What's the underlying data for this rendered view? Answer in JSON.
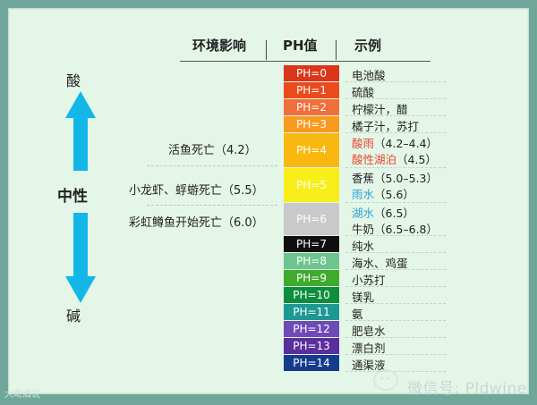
{
  "header": {
    "effect": "环境影响",
    "ph": "PH值",
    "example": "示例"
  },
  "side": {
    "acid": "酸",
    "neutral": "中性",
    "base": "碱"
  },
  "effects": [
    {
      "text": "活鱼死亡（4.2）"
    },
    {
      "text": "小龙虾、蜉蝣死亡（5.5）"
    },
    {
      "text": "彩虹鳟鱼开始死亡（6.0）"
    }
  ],
  "ph_levels": [
    {
      "label": "PH=0",
      "color": "#d9361b",
      "example": [
        {
          "t": "电池酸",
          "c": "#222222"
        }
      ]
    },
    {
      "label": "PH=1",
      "color": "#ea4a1c",
      "example": [
        {
          "t": "硫酸",
          "c": "#222222"
        }
      ]
    },
    {
      "label": "PH=2",
      "color": "#f06f3a",
      "example": [
        {
          "t": "柠檬汁，醋",
          "c": "#222222"
        }
      ]
    },
    {
      "label": "PH=3",
      "color": "#f79a20",
      "example": [
        {
          "t": "橘子汁，苏打",
          "c": "#222222"
        }
      ]
    },
    {
      "label": "PH=4",
      "color": "#f8b80f",
      "example": [
        {
          "t": "酸雨",
          "c": "#e8472a"
        },
        {
          "t": "（4.2–4.4）",
          "c": "#222222"
        }
      ],
      "example2": [
        {
          "t": "酸性湖泊",
          "c": "#e8472a"
        },
        {
          "t": "（4.5）",
          "c": "#222222"
        }
      ]
    },
    {
      "label": "PH=5",
      "color": "#f8ee1a",
      "example": [
        {
          "t": "香蕉（5.0–5.3）",
          "c": "#222222"
        }
      ],
      "example2": [
        {
          "t": "雨水",
          "c": "#2ea3d8"
        },
        {
          "t": "（5.6）",
          "c": "#222222"
        }
      ]
    },
    {
      "label": "PH=6",
      "color": "#c9c9c9",
      "example": [
        {
          "t": "湖水",
          "c": "#2ea3d8"
        },
        {
          "t": "（6.5）",
          "c": "#222222"
        }
      ],
      "example2": [
        {
          "t": "牛奶（6.5–6.8）",
          "c": "#222222"
        }
      ]
    },
    {
      "label": "PH=7",
      "color": "#0f0f0f",
      "example": [
        {
          "t": "纯水",
          "c": "#222222"
        }
      ]
    },
    {
      "label": "PH=8",
      "color": "#6cc58e",
      "example": [
        {
          "t": "海水、鸡蛋",
          "c": "#222222"
        }
      ]
    },
    {
      "label": "PH=9",
      "color": "#3faa2c",
      "example": [
        {
          "t": "小苏打",
          "c": "#222222"
        }
      ]
    },
    {
      "label": "PH=10",
      "color": "#0c8e3d",
      "example": [
        {
          "t": "镁乳",
          "c": "#222222"
        }
      ]
    },
    {
      "label": "PH=11",
      "color": "#1d9892",
      "example": [
        {
          "t": "氨",
          "c": "#222222"
        }
      ]
    },
    {
      "label": "PH=12",
      "color": "#6d4ab7",
      "example": [
        {
          "t": "肥皂水",
          "c": "#222222"
        }
      ]
    },
    {
      "label": "PH=13",
      "color": "#5a2e9e",
      "example": [
        {
          "t": "漂白剂",
          "c": "#222222"
        }
      ]
    },
    {
      "label": "PH=14",
      "color": "#143c8e",
      "example": [
        {
          "t": "通渠液",
          "c": "#222222"
        }
      ]
    }
  ],
  "watermark": {
    "wechat": "微信号: Pldwine",
    "logo": "大毗酒说"
  },
  "colors": {
    "arrow": "#12b7e8",
    "background": "#6fa79a",
    "panel": "#e4f6e8"
  }
}
